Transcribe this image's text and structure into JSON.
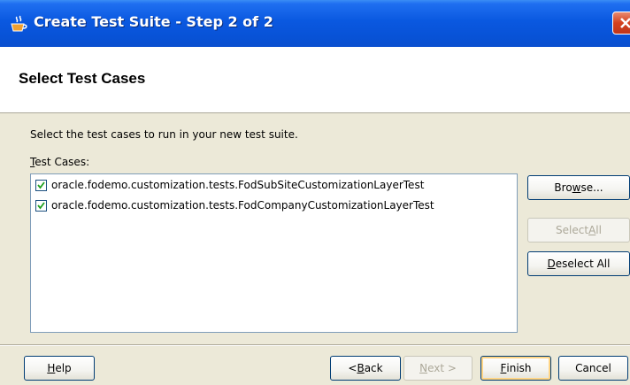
{
  "window": {
    "title": "Create Test Suite - Step 2 of 2",
    "icon": "coffee-cup-icon"
  },
  "header": {
    "title": "Select Test Cases"
  },
  "main": {
    "instruction": "Select the test cases to run in your new test suite.",
    "cases_label_prefix": "T",
    "cases_label_rest": "est Cases:",
    "test_cases": [
      {
        "label": "oracle.fodemo.customization.tests.FodSubSiteCustomizationLayerTest",
        "checked": true
      },
      {
        "label": "oracle.fodemo.customization.tests.FodCompanyCustomizationLayerTest",
        "checked": true
      }
    ]
  },
  "side_buttons": {
    "browse": {
      "pre": "Bro",
      "mn": "w",
      "post": "se..."
    },
    "select_all": {
      "pre": "Select ",
      "mn": "A",
      "post": "ll"
    },
    "deselect_all": {
      "pre": "",
      "mn": "D",
      "post": "eselect All"
    }
  },
  "footer": {
    "help": {
      "pre": "",
      "mn": "H",
      "post": "elp"
    },
    "back": {
      "pre": "< ",
      "mn": "B",
      "post": "ack"
    },
    "next": {
      "pre": "",
      "mn": "N",
      "post": "ext >"
    },
    "finish": {
      "pre": "",
      "mn": "F",
      "post": "inish"
    },
    "cancel": "Cancel"
  },
  "colors": {
    "titlebar": "#0a58e0",
    "close": "#d3411e",
    "dialog_bg": "#ece9d8"
  }
}
